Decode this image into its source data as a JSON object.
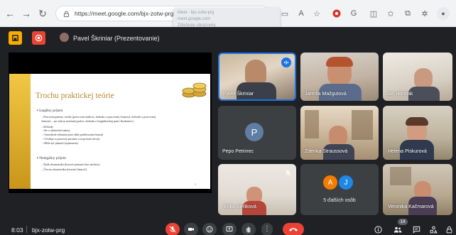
{
  "browser": {
    "url": "https://meet.google.com/bjx-zotw-prg",
    "tab_preview_title": "Meet - bjx-zotw-prg",
    "tab_preview_url": "meet.google.com",
    "tab_preview_memory": "Zdieľanie obrazovky"
  },
  "header": {
    "presenter_label": "Pavel Škriniar (Prezentovanie)"
  },
  "slide": {
    "title": "Trochu praktickej teórie",
    "lines": [
      "▪ Legálny príjem",
      "– Pracovnoprávny vzťah (pracovná zmluva, dohoda o pracovnej činnosti, dohoda o pracovnej",
      "  činnosti – na výkon sezónnej práce, dohoda o brigádnickej práci študentov)",
      "– Dohody",
      "  ▫ Ide o výnimočné zmluvy",
      "  ▫ Vymedzené výkonom práce alebo pridelovaním činností",
      "  ▫ Vzťahuje sa pracovný poistenie a sú povinné odvody",
      "  ▫ Môžu byť platené (trojmesačne)",
      "▪ Nelegálny príjem",
      "– Šedá ekonomika (hotové peniaze bez zmluvy)",
      "– Čierna ekonomika (trestná činnosť)"
    ],
    "page": "3"
  },
  "participants": [
    {
      "name": "Pavel Škriniar"
    },
    {
      "name": "Jarmila Mažgutová"
    },
    {
      "name": "Ján Horniak"
    },
    {
      "name": "Pepo Petrinec",
      "avatar_letter": "P"
    },
    {
      "name": "Zdenka Straussová"
    },
    {
      "name": "Helena Piskurová"
    },
    {
      "name": "Erika Bieliková"
    },
    {
      "name": "Veronika Kačmarová"
    }
  ],
  "others": {
    "label": "5 ďalších osôb",
    "letters": [
      "A",
      "J"
    ]
  },
  "bottom": {
    "time": "8:03",
    "meeting_code": "bjx-zotw-prg",
    "participants_count": "14"
  },
  "colors": {
    "meet_bg": "#202124",
    "tile_bg": "#3c4043",
    "end_call": "#ea4335",
    "accent_blue": "#1a73e8",
    "presenting_yellow": "#f9ab00",
    "pepo_avatar": "#5f7ea3",
    "avatar_a": "#f57c00",
    "avatar_j": "#1e88e5"
  }
}
